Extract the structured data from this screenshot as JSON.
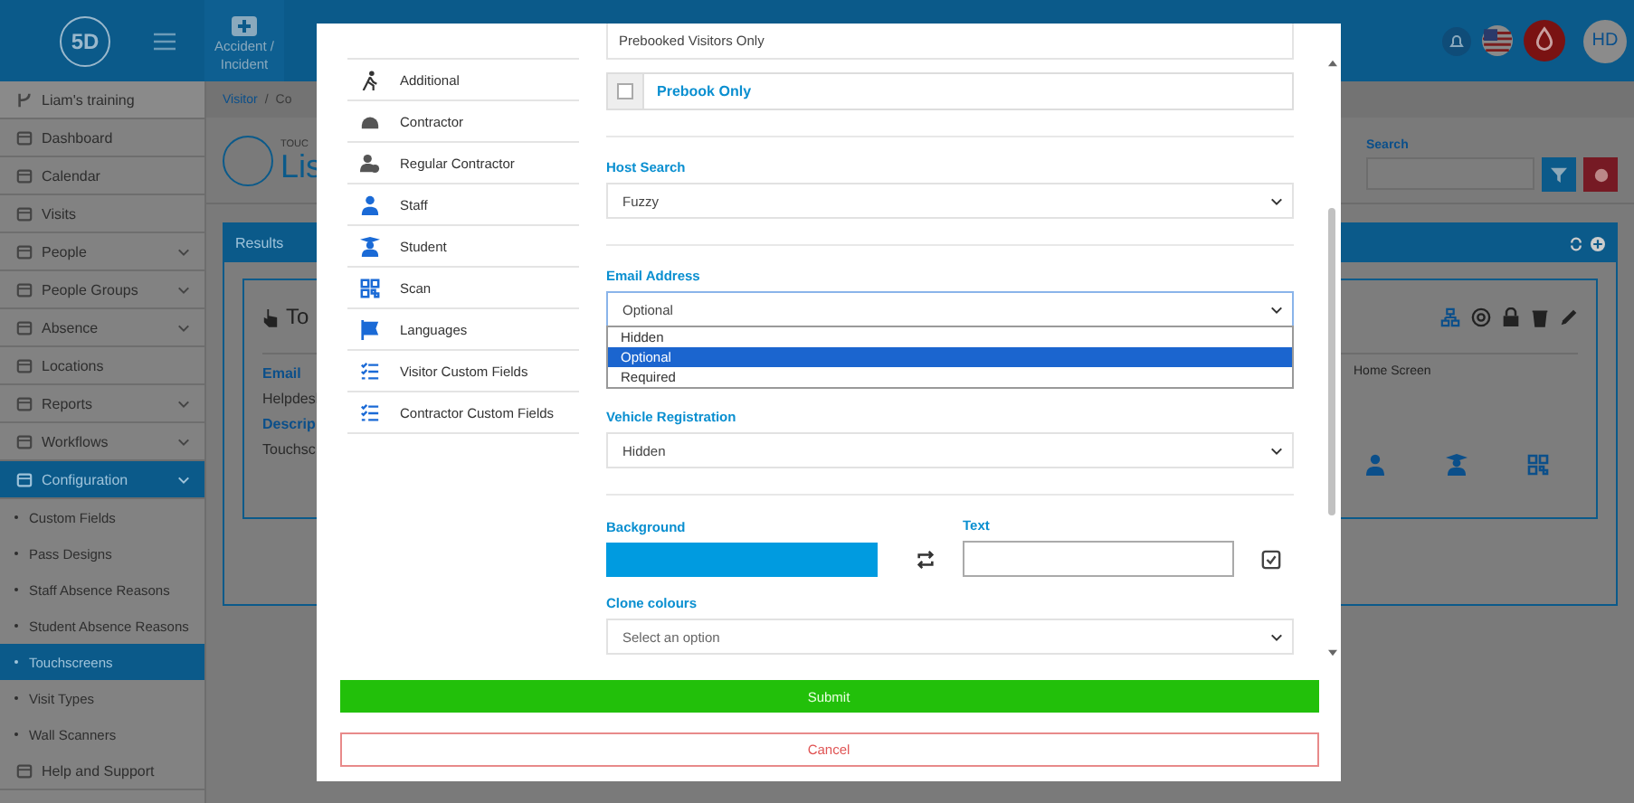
{
  "header": {
    "logo": "5D",
    "nav": [
      {
        "label": "Accident / Incident"
      }
    ],
    "avatar": "HD"
  },
  "sidebar": {
    "project": "Liam's training",
    "items": [
      {
        "label": "Dashboard",
        "expandable": false,
        "selected": false
      },
      {
        "label": "Calendar",
        "expandable": false,
        "selected": false
      },
      {
        "label": "Visits",
        "expandable": false,
        "selected": false
      },
      {
        "label": "People",
        "expandable": true,
        "selected": false
      },
      {
        "label": "People Groups",
        "expandable": true,
        "selected": false
      },
      {
        "label": "Absence",
        "expandable": true,
        "selected": false
      },
      {
        "label": "Locations",
        "expandable": false,
        "selected": false
      },
      {
        "label": "Reports",
        "expandable": true,
        "selected": false
      },
      {
        "label": "Workflows",
        "expandable": true,
        "selected": false
      },
      {
        "label": "Configuration",
        "expandable": true,
        "selected": true,
        "children": [
          {
            "label": "Custom Fields",
            "selected": false
          },
          {
            "label": "Pass Designs",
            "selected": false
          },
          {
            "label": "Staff Absence Reasons",
            "selected": false
          },
          {
            "label": "Student Absence Reasons",
            "selected": false
          },
          {
            "label": "Touchscreens",
            "selected": true
          },
          {
            "label": "Visit Types",
            "selected": false
          },
          {
            "label": "Wall Scanners",
            "selected": false
          }
        ]
      },
      {
        "label": "Help and Support",
        "expandable": false,
        "selected": false
      }
    ]
  },
  "content": {
    "breadcrumb": [
      "Visitor",
      "/",
      "Co"
    ],
    "page_subtitle": "TOUC",
    "page_title": "Lis",
    "results_title": "Results",
    "card_title": "To",
    "card_fields": [
      {
        "label": "Email",
        "value": "Helpdesl"
      },
      {
        "label": "Descrip",
        "value": "Touchsc"
      }
    ],
    "search_label": "Search",
    "home_screen": "Home Screen"
  },
  "modal": {
    "nav": [
      {
        "label": "Additional"
      },
      {
        "label": "Contractor"
      },
      {
        "label": "Regular Contractor"
      },
      {
        "label": "Staff"
      },
      {
        "label": "Student"
      },
      {
        "label": "Scan"
      },
      {
        "label": "Languages"
      },
      {
        "label": "Visitor Custom Fields"
      },
      {
        "label": "Contractor Custom Fields"
      }
    ],
    "fields": [
      {
        "kind": "text",
        "value": "Prebooked Visitors Only"
      },
      {
        "kind": "checkbox",
        "label": "Prebook Only",
        "checked": false
      },
      {
        "kind": "divider"
      },
      {
        "kind": "select",
        "label": "Host Search",
        "value": "Fuzzy",
        "open": false
      },
      {
        "kind": "divider"
      },
      {
        "kind": "select",
        "label": "Email Address",
        "value": "Optional",
        "open": true,
        "options": [
          {
            "label": "Hidden",
            "selected": false
          },
          {
            "label": "Optional",
            "selected": true
          },
          {
            "label": "Required",
            "selected": false
          }
        ]
      },
      {
        "kind": "select",
        "label": "Vehicle Registration",
        "value": "Hidden",
        "open": false
      },
      {
        "kind": "divider"
      },
      {
        "kind": "colors",
        "background_label": "Background",
        "text_label": "Text"
      },
      {
        "kind": "select",
        "label": "Clone colours",
        "placeholder": "Select an option",
        "open": false
      }
    ],
    "submit": "Submit",
    "cancel": "Cancel"
  }
}
